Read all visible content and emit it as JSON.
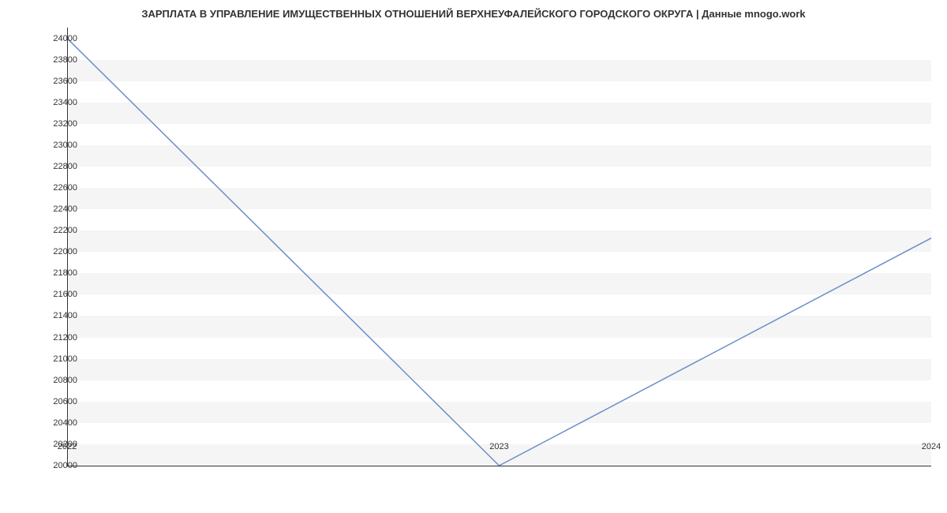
{
  "chart_data": {
    "type": "line",
    "title": "ЗАРПЛАТА В УПРАВЛЕНИЕ ИМУЩЕСТВЕННЫХ ОТНОШЕНИЙ ВЕРХНЕУФАЛЕЙСКОГО ГОРОДСКОГО ОКРУГА | Данные mnogo.work",
    "x": [
      2022,
      2023,
      2024
    ],
    "values": [
      24000,
      20000,
      22130
    ],
    "xlabel": "",
    "ylabel": "",
    "x_ticks": [
      2022,
      2023,
      2024
    ],
    "y_ticks": [
      20000,
      20200,
      20400,
      20600,
      20800,
      21000,
      21200,
      21400,
      21600,
      21800,
      22000,
      22200,
      22400,
      22600,
      22800,
      23000,
      23200,
      23400,
      23600,
      23800,
      24000
    ],
    "ylim": [
      20000,
      24100
    ],
    "xlim": [
      2022,
      2024
    ],
    "line_color": "#6b8fc9",
    "grid": true
  }
}
